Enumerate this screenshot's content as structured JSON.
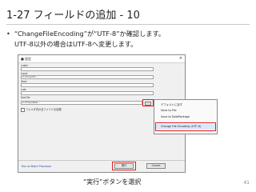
{
  "slide": {
    "title": "1-27  フィールドの追加 - 10",
    "bullet_line1": "“ChangeFileEncoding”が“UTF-8”か確認します。",
    "bullet_line2": "UTF-8以外の場合はUTF-8へ変更します。",
    "bullet_marker": "•",
    "caption": "“実行”ボタンを選択",
    "page_number": "41"
  },
  "dialog": {
    "title": "■ 設定",
    "close_glyph": "×",
    "fields": [
      {
        "label": "Label",
        "value": ""
      },
      {
        "label": "Input",
        "value": "C:/Fme/UT/..."
      },
      {
        "label": "Start",
        "value": ""
      },
      {
        "label": "Last",
        "value": ""
      },
      {
        "label": "DocFile",
        "value": ""
      },
      {
        "label": "File",
        "value": "C:/Fme/data/..."
      }
    ],
    "checkbox_label": "フォルダ内の全ファイルを処理",
    "more_label": "...",
    "bottom_link": "Run as Batch Processor",
    "run_label": "実行",
    "cancel_label": "Cancel"
  },
  "menu": {
    "items": [
      "デフォルトに戻す",
      "Save to File",
      "Save to DataPackage",
      "Change File Encoding (UTF-8)"
    ]
  },
  "colors": {
    "highlight": "#e02020",
    "menu_selected": "#d9e8fb"
  }
}
